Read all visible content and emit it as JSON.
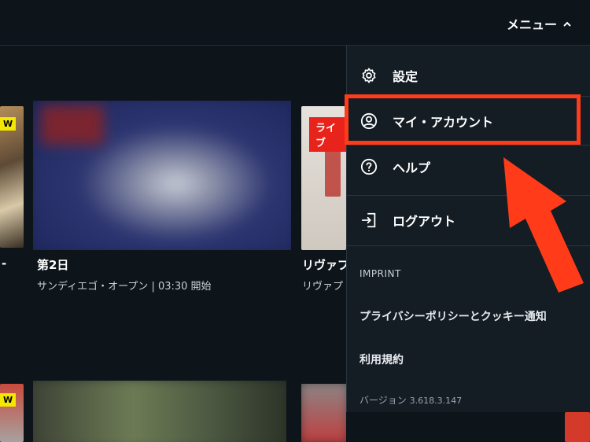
{
  "header": {
    "menu_label": "メニュー",
    "menu_chevron": "^"
  },
  "cards_row1": [
    {
      "title": "-",
      "badge": "W"
    },
    {
      "title": "第2日",
      "subtitle": "サンディエゴ・オープン | 03:30 開始"
    },
    {
      "title": "リヴァプ",
      "subtitle": "リヴァプ",
      "badge": "ライブ"
    }
  ],
  "cards_row2_badge": "W",
  "dropdown": {
    "items": [
      {
        "label": "設定",
        "icon": "gear-icon"
      },
      {
        "label": "マイ・アカウント",
        "icon": "account-icon"
      },
      {
        "label": "ヘルプ",
        "icon": "help-icon"
      },
      {
        "label": "ログアウト",
        "icon": "logout-icon"
      }
    ],
    "imprint_label": "IMPRINT",
    "privacy_link": "プライバシーポリシーとクッキー通知",
    "terms_link": "利用規約",
    "version_label": "バージョン",
    "version_number": "3.618.3.147"
  },
  "colors": {
    "background": "#0d141a",
    "highlight": "#ff3b1a",
    "live_badge": "#e8231b"
  }
}
